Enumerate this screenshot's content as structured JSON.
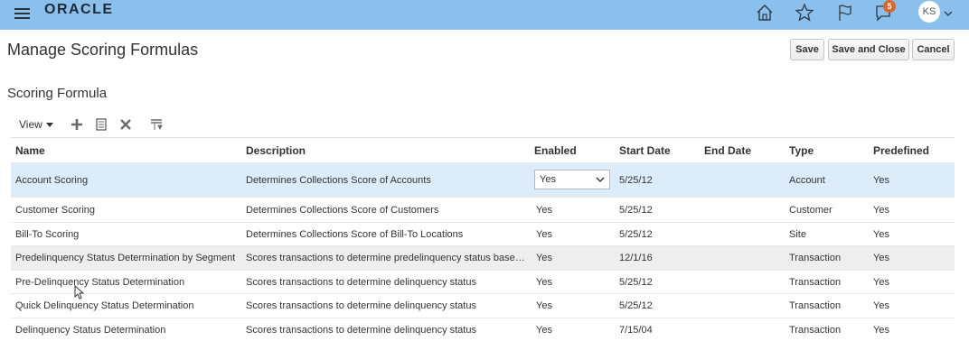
{
  "header": {
    "logo": "ORACLE",
    "notification_count": "5",
    "user_initials": "KS",
    "bar_color": "#8cc0ec"
  },
  "page": {
    "title": "Manage Scoring Formulas",
    "section_title": "Scoring Formula",
    "buttons": {
      "save": "Save",
      "save_close": "Save and Close",
      "cancel": "Cancel"
    }
  },
  "toolbar": {
    "view_label": "View",
    "icons": [
      "add-icon",
      "detach-icon",
      "delete-icon",
      "freeze-icon"
    ]
  },
  "table": {
    "columns": [
      "Name",
      "Description",
      "Enabled",
      "Start Date",
      "End Date",
      "Type",
      "Predefined"
    ],
    "rows": [
      {
        "name": "Account Scoring",
        "description": "Determines Collections Score of Accounts",
        "enabled": "Yes",
        "start": "5/25/12",
        "end": "",
        "type": "Account",
        "predefined": "Yes"
      },
      {
        "name": "Customer Scoring",
        "description": "Determines Collections Score of Customers",
        "enabled": "Yes",
        "start": "5/25/12",
        "end": "",
        "type": "Customer",
        "predefined": "Yes"
      },
      {
        "name": "Bill-To Scoring",
        "description": "Determines Collections Score of Bill-To Locations",
        "enabled": "Yes",
        "start": "5/25/12",
        "end": "",
        "type": "Site",
        "predefined": "Yes"
      },
      {
        "name": "Predelinquency Status Determination by Segment",
        "description": "Scores transactions to determine predelinquency status based on …",
        "enabled": "Yes",
        "start": "12/1/16",
        "end": "",
        "type": "Transaction",
        "predefined": "Yes"
      },
      {
        "name": "Pre-Delinquency Status Determination",
        "description": "Scores transactions to determine delinquency status",
        "enabled": "Yes",
        "start": "5/25/12",
        "end": "",
        "type": "Transaction",
        "predefined": "Yes"
      },
      {
        "name": "Quick Delinquency Status Determination",
        "description": "Scores transactions to determine delinquency status",
        "enabled": "Yes",
        "start": "5/25/12",
        "end": "",
        "type": "Transaction",
        "predefined": "Yes"
      },
      {
        "name": "Delinquency Status Determination",
        "description": "Scores transactions to determine delinquency status",
        "enabled": "Yes",
        "start": "7/15/04",
        "end": "",
        "type": "Transaction",
        "predefined": "Yes"
      }
    ]
  }
}
